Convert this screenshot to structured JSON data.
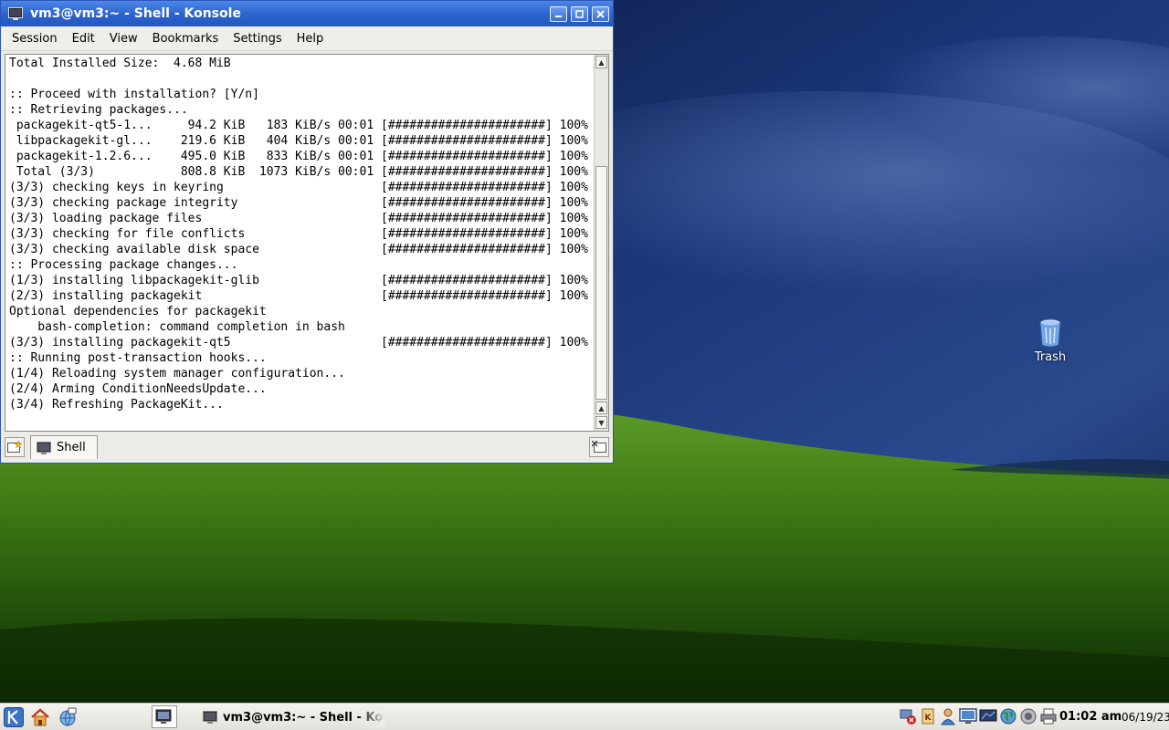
{
  "window": {
    "title": "vm3@vm3:~ - Shell - Konsole",
    "menu": [
      "Session",
      "Edit",
      "View",
      "Bookmarks",
      "Settings",
      "Help"
    ],
    "tab_label": "Shell"
  },
  "terminal": {
    "lines": [
      "Total Installed Size:  4.68 MiB",
      "",
      ":: Proceed with installation? [Y/n]",
      ":: Retrieving packages...",
      " packagekit-qt5-1...     94.2 KiB   183 KiB/s 00:01 [######################] 100%",
      " libpackagekit-gl...    219.6 KiB   404 KiB/s 00:01 [######################] 100%",
      " packagekit-1.2.6...    495.0 KiB   833 KiB/s 00:01 [######################] 100%",
      " Total (3/3)            808.8 KiB  1073 KiB/s 00:01 [######################] 100%",
      "(3/3) checking keys in keyring                      [######################] 100%",
      "(3/3) checking package integrity                    [######################] 100%",
      "(3/3) loading package files                         [######################] 100%",
      "(3/3) checking for file conflicts                   [######################] 100%",
      "(3/3) checking available disk space                 [######################] 100%",
      ":: Processing package changes...",
      "(1/3) installing libpackagekit-glib                 [######################] 100%",
      "(2/3) installing packagekit                         [######################] 100%",
      "Optional dependencies for packagekit",
      "    bash-completion: command completion in bash",
      "(3/3) installing packagekit-qt5                     [######################] 100%",
      ":: Running post-transaction hooks...",
      "(1/4) Reloading system manager configuration...",
      "(2/4) Arming ConditionNeedsUpdate...",
      "(3/4) Refreshing PackageKit..."
    ]
  },
  "desktop": {
    "icons": [
      {
        "label": "Trash",
        "icon": "trash-icon"
      }
    ]
  },
  "taskbar": {
    "task_label": "vm3@vm3:~ - Shell - Ko",
    "clock": "01:02 am",
    "date": "06/19/23",
    "tray_icons": [
      "network-error-icon",
      "klipper-icon",
      "user-icon",
      "display-icon",
      "monitor-icon",
      "globe-icon",
      "speaker-icon",
      "printer-icon"
    ]
  },
  "colors": {
    "titlebar": "#2c62cc",
    "sky": "#0b1a3e",
    "grass": "#3c7a16"
  }
}
